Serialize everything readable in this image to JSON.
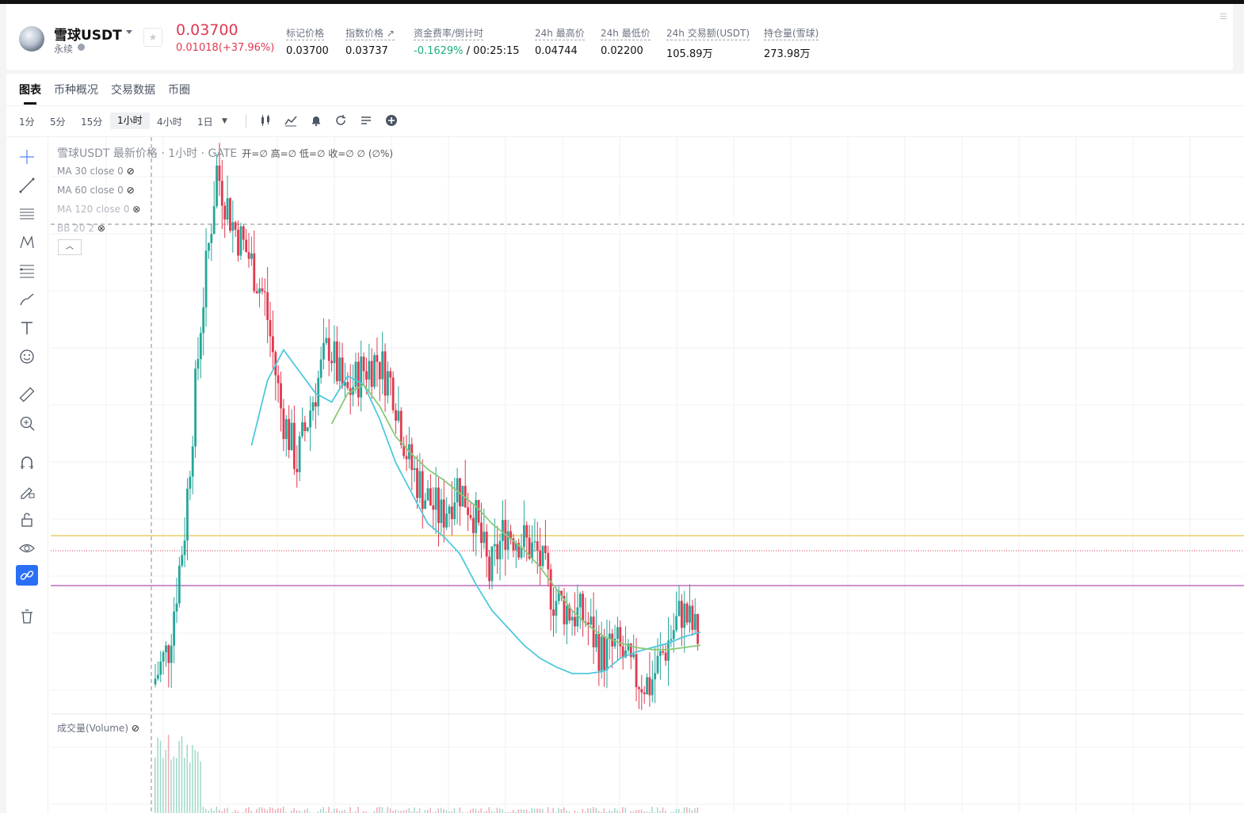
{
  "ticker": {
    "name": "雪球USDT",
    "type": "永续",
    "price": "0.03700",
    "change": "0.01018(+37.96%)",
    "stats": [
      {
        "label": "标记价格",
        "value": "0.03700"
      },
      {
        "label": "指数价格 ↗",
        "value": "0.03737"
      },
      {
        "label": "资金费率/倒计时",
        "value_green": "-0.1629%",
        "value": " / 00:25:15"
      },
      {
        "label": "24h 最高价",
        "value": "0.04744"
      },
      {
        "label": "24h 最低价",
        "value": "0.02200"
      },
      {
        "label": "24h 交易额(USDT)",
        "value": "105.89万"
      },
      {
        "label": "持仓量(雪球)",
        "value": "273.98万"
      }
    ]
  },
  "tabs": [
    "图表",
    "币种概况",
    "交易数据",
    "币圈"
  ],
  "intervals": [
    "1分",
    "5分",
    "15分",
    "1小时",
    "4小时",
    "1日"
  ],
  "active_interval": "1小时",
  "chart_legend": {
    "title": "雪球USDT 最新价格 · 1小时 · GATE",
    "ohlc": "开=∅ 高=∅ 低=∅ 收=∅ ∅ (∅%)",
    "indicators": [
      "MA 30 close 0",
      "MA 60 close 0",
      "MA 120 close 0",
      "BB 20 2"
    ],
    "volume": "成交量(Volume)"
  },
  "colors": {
    "up": "#26a69a",
    "down": "#e0394f",
    "ma30": "#4ec9dc",
    "ma60": "#8cc97a",
    "hline_yellow": "#e3c24c",
    "hline_purple": "#b04fb3"
  },
  "chart_data": {
    "type": "candlestick",
    "series": [
      {
        "name": "price_close",
        "values": [
          0.0228,
          0.0245,
          0.03,
          0.0395,
          0.0465,
          0.044,
          0.0425,
          0.0405,
          0.0355,
          0.033,
          0.036,
          0.0385,
          0.036,
          0.0372,
          0.0378,
          0.0365,
          0.033,
          0.0315,
          0.0305,
          0.032,
          0.0308,
          0.0278,
          0.03,
          0.0295,
          0.0288,
          0.0268,
          0.0262,
          0.0258,
          0.0242,
          0.0245,
          0.0232,
          0.0228,
          0.0245,
          0.0262,
          0.025
        ]
      },
      {
        "name": "MA 30",
        "values": [
          null,
          null,
          null,
          null,
          null,
          null,
          0.0338,
          0.0368,
          0.0382,
          0.0372,
          0.0362,
          0.0358,
          0.037,
          0.0366,
          0.035,
          0.033,
          0.0316,
          0.0302,
          0.0296,
          0.0288,
          0.0274,
          0.0262,
          0.0254,
          0.0246,
          0.024,
          0.0236,
          0.0233,
          0.0233,
          0.0234,
          0.024,
          0.0243,
          0.0245,
          0.0247,
          0.025,
          0.0252
        ]
      },
      {
        "name": "MA 60",
        "values": [
          null,
          null,
          null,
          null,
          null,
          null,
          null,
          null,
          null,
          null,
          null,
          0.0348,
          0.0362,
          0.0366,
          0.0356,
          0.0342,
          0.0334,
          0.0327,
          0.0322,
          0.0316,
          0.031,
          0.0302,
          0.0296,
          0.029,
          0.0282,
          0.0272,
          0.0262,
          0.0255,
          0.025,
          0.0247,
          0.0245,
          0.0244,
          0.0244,
          0.0245,
          0.0246
        ]
      }
    ]
  }
}
